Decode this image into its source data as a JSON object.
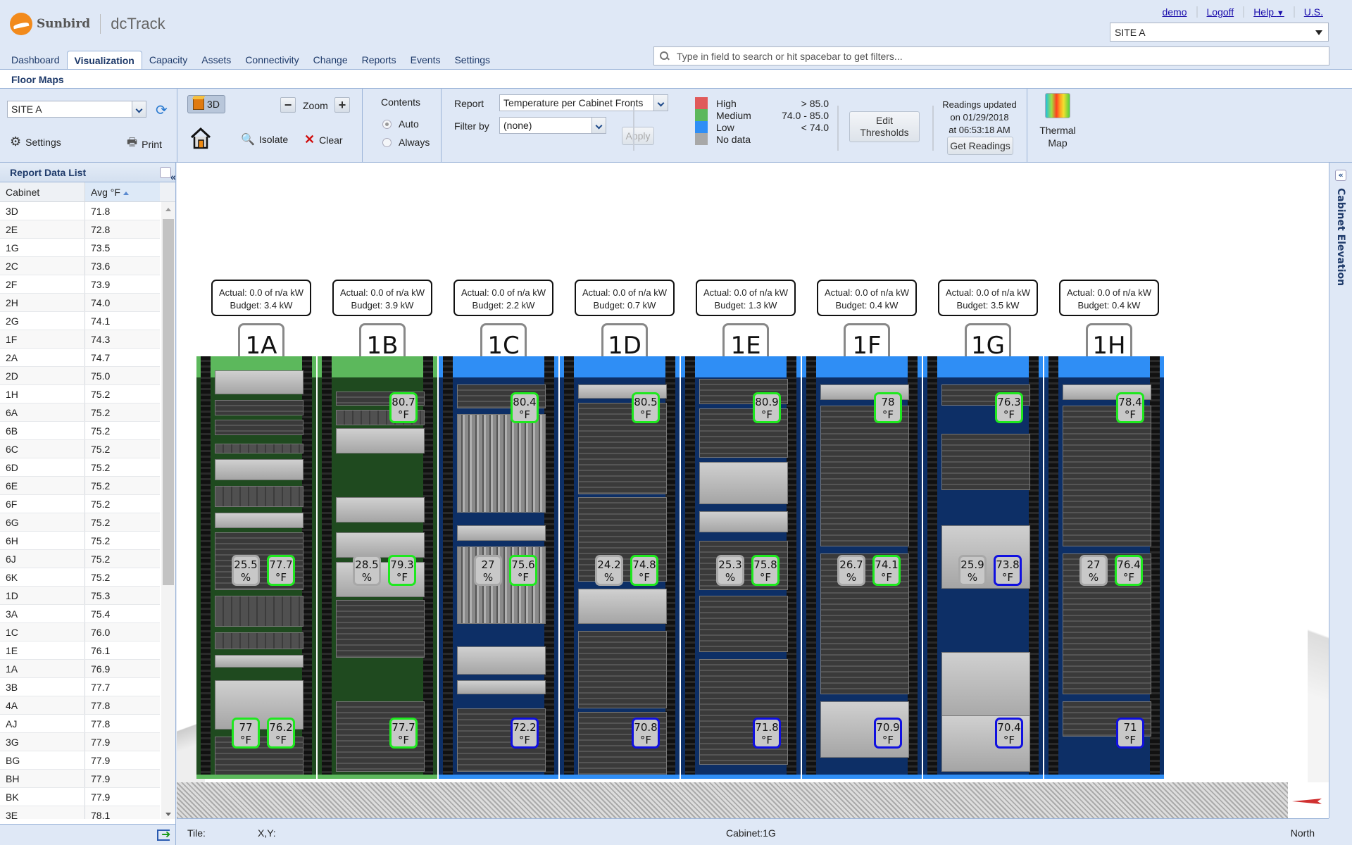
{
  "header": {
    "brand": "Sunbird",
    "product": "dcTrack",
    "links": [
      "demo",
      "Logoff",
      "Help",
      "U.S."
    ],
    "site_select": "SITE A",
    "search_placeholder": "Type in field to search or hit spacebar to get filters...",
    "tabs": [
      {
        "label": "Dashboard",
        "active": false
      },
      {
        "label": "Visualization",
        "active": true
      },
      {
        "label": "Capacity",
        "active": false
      },
      {
        "label": "Assets",
        "active": false
      },
      {
        "label": "Connectivity",
        "active": false
      },
      {
        "label": "Change",
        "active": false
      },
      {
        "label": "Reports",
        "active": false
      },
      {
        "label": "Events",
        "active": false
      },
      {
        "label": "Settings",
        "active": false
      }
    ]
  },
  "page_title": "Floor Maps",
  "toolbar": {
    "location_select": "SITE A",
    "settings_label": "Settings",
    "print_label": "Print",
    "view_3d_label": "3D",
    "zoom_label": "Zoom",
    "zoom_out": "−",
    "zoom_in": "+",
    "isolate_label": "Isolate",
    "clear_label": "Clear",
    "contents": {
      "title": "Contents",
      "options": [
        {
          "label": "Auto",
          "checked": true
        },
        {
          "label": "Always",
          "checked": false
        }
      ]
    },
    "report_label": "Report",
    "report_value": "Temperature per Cabinet Fronts",
    "filter_label": "Filter by",
    "filter_value": "(none)",
    "apply_label": "Apply",
    "legend": [
      {
        "label": "High",
        "range": "> 85.0",
        "color": "#e05a5a"
      },
      {
        "label": "Medium",
        "range": "74.0 - 85.0",
        "color": "#5cb85c"
      },
      {
        "label": "Low",
        "range": "< 74.0",
        "color": "#2f8ef5"
      },
      {
        "label": "No data",
        "range": "",
        "color": "#a8a8a8"
      }
    ],
    "edit_thresholds_line1": "Edit",
    "edit_thresholds_line2": "Thresholds",
    "readings_line1": "Readings updated",
    "readings_line2": "on 01/29/2018",
    "readings_line3": "at 06:53:18 AM",
    "get_readings_label": "Get Readings",
    "thermal_map_line1": "Thermal",
    "thermal_map_line2": "Map"
  },
  "report_list": {
    "title": "Report Data List",
    "columns": [
      "Cabinet",
      "Avg °F"
    ],
    "rows": [
      [
        "3D",
        "71.8"
      ],
      [
        "2E",
        "72.8"
      ],
      [
        "1G",
        "73.5"
      ],
      [
        "2C",
        "73.6"
      ],
      [
        "2F",
        "73.9"
      ],
      [
        "2H",
        "74.0"
      ],
      [
        "2G",
        "74.1"
      ],
      [
        "1F",
        "74.3"
      ],
      [
        "2A",
        "74.7"
      ],
      [
        "2D",
        "75.0"
      ],
      [
        "1H",
        "75.2"
      ],
      [
        "6A",
        "75.2"
      ],
      [
        "6B",
        "75.2"
      ],
      [
        "6C",
        "75.2"
      ],
      [
        "6D",
        "75.2"
      ],
      [
        "6E",
        "75.2"
      ],
      [
        "6F",
        "75.2"
      ],
      [
        "6G",
        "75.2"
      ],
      [
        "6H",
        "75.2"
      ],
      [
        "6J",
        "75.2"
      ],
      [
        "6K",
        "75.2"
      ],
      [
        "1D",
        "75.3"
      ],
      [
        "3A",
        "75.4"
      ],
      [
        "1C",
        "76.0"
      ],
      [
        "1E",
        "76.1"
      ],
      [
        "1A",
        "76.9"
      ],
      [
        "3B",
        "77.7"
      ],
      [
        "4A",
        "77.8"
      ],
      [
        "AJ",
        "77.8"
      ],
      [
        "3G",
        "77.9"
      ],
      [
        "BG",
        "77.9"
      ],
      [
        "BH",
        "77.9"
      ],
      [
        "BK",
        "77.9"
      ],
      [
        "3E",
        "78.1"
      ]
    ]
  },
  "cabinets": [
    {
      "name": "1A",
      "actual": "Actual: 0.0 of n/a kW",
      "budget": "Budget: 3.4 kW",
      "status": "medium",
      "top": null,
      "mid_hum": "25.5",
      "mid_temp": {
        "v": "77.7",
        "level": "med"
      },
      "bottom": [
        {
          "v": "77",
          "level": "med"
        },
        {
          "v": "76.2",
          "level": "med"
        }
      ]
    },
    {
      "name": "1B",
      "actual": "Actual: 0.0 of n/a kW",
      "budget": "Budget: 3.9 kW",
      "status": "medium",
      "top": {
        "v": "80.7",
        "level": "med"
      },
      "mid_hum": "28.5",
      "mid_temp": {
        "v": "79.3",
        "level": "med"
      },
      "bottom": [
        {
          "v": "77.7",
          "level": "med"
        }
      ]
    },
    {
      "name": "1C",
      "actual": "Actual: 0.0 of n/a kW",
      "budget": "Budget: 2.2 kW",
      "status": "low",
      "top": {
        "v": "80.4",
        "level": "med"
      },
      "mid_hum": "27",
      "mid_temp": {
        "v": "75.6",
        "level": "med"
      },
      "bottom": [
        {
          "v": "72.2",
          "level": "low"
        }
      ]
    },
    {
      "name": "1D",
      "actual": "Actual: 0.0 of n/a kW",
      "budget": "Budget: 0.7 kW",
      "status": "low",
      "top": {
        "v": "80.5",
        "level": "med"
      },
      "mid_hum": "24.2",
      "mid_temp": {
        "v": "74.8",
        "level": "med"
      },
      "bottom": [
        {
          "v": "70.8",
          "level": "low"
        }
      ]
    },
    {
      "name": "1E",
      "actual": "Actual: 0.0 of n/a kW",
      "budget": "Budget: 1.3 kW",
      "status": "low",
      "top": {
        "v": "80.9",
        "level": "med"
      },
      "mid_hum": "25.3",
      "mid_temp": {
        "v": "75.8",
        "level": "med"
      },
      "bottom": [
        {
          "v": "71.8",
          "level": "low"
        }
      ]
    },
    {
      "name": "1F",
      "actual": "Actual: 0.0 of n/a kW",
      "budget": "Budget: 0.4 kW",
      "status": "low",
      "top": {
        "v": "78",
        "level": "med"
      },
      "mid_hum": "26.7",
      "mid_temp": {
        "v": "74.1",
        "level": "med"
      },
      "bottom": [
        {
          "v": "70.9",
          "level": "low"
        }
      ]
    },
    {
      "name": "1G",
      "actual": "Actual: 0.0 of n/a kW",
      "budget": "Budget: 3.5 kW",
      "status": "low",
      "top": {
        "v": "76.3",
        "level": "med"
      },
      "mid_hum": "25.9",
      "mid_temp": {
        "v": "73.8",
        "level": "low"
      },
      "bottom": [
        {
          "v": "70.4",
          "level": "low"
        }
      ]
    },
    {
      "name": "1H",
      "actual": "Actual: 0.0 of n/a kW",
      "budget": "Budget: 0.4 kW",
      "status": "low",
      "top": {
        "v": "78.4",
        "level": "med"
      },
      "mid_hum": "27",
      "mid_temp": {
        "v": "76.4",
        "level": "med"
      },
      "bottom": [
        {
          "v": "71",
          "level": "low"
        }
      ]
    }
  ],
  "units": {
    "temp": "°F",
    "humidity": "%"
  },
  "right_panel": {
    "label": "Cabinet Elevation"
  },
  "status_bar": {
    "tile": "Tile:",
    "xy": "X,Y:",
    "cabinet": "Cabinet:1G",
    "orientation": "North"
  },
  "colors": {
    "medium_rack": "#5cb85c",
    "low_rack": "#2f8ef5",
    "medium_border": "#1fe81f",
    "low_border": "#1010e0"
  }
}
